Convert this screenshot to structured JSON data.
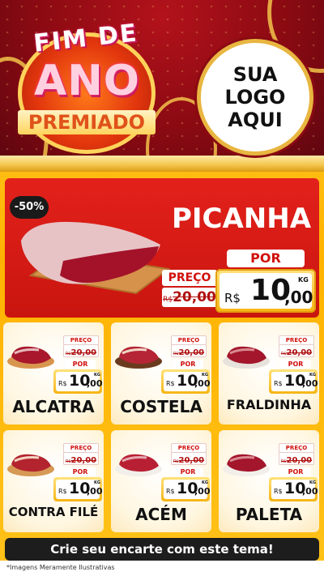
{
  "header": {
    "title_line1": "FIM DE",
    "title_line2": "ANO",
    "title_line3": "PREMIADO",
    "logo_line1": "SUA",
    "logo_line2": "LOGO",
    "logo_line3": "AQUI"
  },
  "featured": {
    "discount": "-50%",
    "name": "PICANHA",
    "preco_label": "PREÇO",
    "old_currency": "R$",
    "old_price": "20,00",
    "por_label": "POR",
    "currency": "R$",
    "price_int": "10",
    "price_dec": ",00",
    "unit": "KG"
  },
  "products": [
    {
      "name": "ALCATRA",
      "preco_label": "PREÇO",
      "old_currency": "R$",
      "old_price": "20,00",
      "por_label": "POR",
      "currency": "R$",
      "price_int": "10",
      "price_dec": ",00",
      "unit": "KG"
    },
    {
      "name": "COSTELA",
      "preco_label": "PREÇO",
      "old_currency": "R$",
      "old_price": "20,00",
      "por_label": "POR",
      "currency": "R$",
      "price_int": "10",
      "price_dec": ",00",
      "unit": "KG"
    },
    {
      "name": "FRALDINHA",
      "preco_label": "PREÇO",
      "old_currency": "R$",
      "old_price": "20,00",
      "por_label": "POR",
      "currency": "R$",
      "price_int": "10",
      "price_dec": ",00",
      "unit": "KG"
    },
    {
      "name": "CONTRA FILÉ",
      "preco_label": "PREÇO",
      "old_currency": "R$",
      "old_price": "20,00",
      "por_label": "POR",
      "currency": "R$",
      "price_int": "10",
      "price_dec": ",00",
      "unit": "KG"
    },
    {
      "name": "ACÉM",
      "preco_label": "PREÇO",
      "old_currency": "R$",
      "old_price": "20,00",
      "por_label": "POR",
      "currency": "R$",
      "price_int": "10",
      "price_dec": ",00",
      "unit": "KG"
    },
    {
      "name": "PALETA",
      "preco_label": "PREÇO",
      "old_currency": "R$",
      "old_price": "20,00",
      "por_label": "POR",
      "currency": "R$",
      "price_int": "10",
      "price_dec": ",00",
      "unit": "KG"
    }
  ],
  "cta": "Crie seu encarte com este tema!",
  "footnote": "*Imagens Meramente Ilustrativas",
  "colors": {
    "red": "#d9160f",
    "gold": "#f5b514",
    "dark": "#1d1d1d",
    "wine": "#8a0a12"
  },
  "icons": [
    "meat-cut-icon",
    "cutting-board-icon"
  ]
}
